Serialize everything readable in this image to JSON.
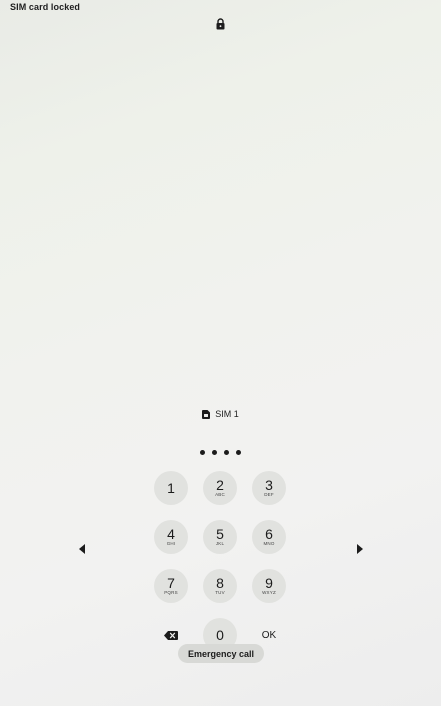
{
  "status_bar": {
    "carrier_text": "SIM card locked"
  },
  "lock": {
    "icon": "lock-icon"
  },
  "sim": {
    "icon": "sim-card-icon",
    "label": "SIM 1"
  },
  "pin": {
    "entered_count": 4
  },
  "keypad": {
    "keys": [
      {
        "digit": "1",
        "letters": ""
      },
      {
        "digit": "2",
        "letters": "ABC"
      },
      {
        "digit": "3",
        "letters": "DEF"
      },
      {
        "digit": "4",
        "letters": "GHI"
      },
      {
        "digit": "5",
        "letters": "JKL"
      },
      {
        "digit": "6",
        "letters": "MNO"
      },
      {
        "digit": "7",
        "letters": "PQRS"
      },
      {
        "digit": "8",
        "letters": "TUV"
      },
      {
        "digit": "9",
        "letters": "WXYZ"
      }
    ],
    "zero": {
      "digit": "0"
    },
    "ok_label": "OK",
    "backspace_icon": "backspace-icon"
  },
  "navigation": {
    "prev_icon": "chevron-left-icon",
    "next_icon": "chevron-right-icon"
  },
  "emergency": {
    "label": "Emergency call"
  }
}
